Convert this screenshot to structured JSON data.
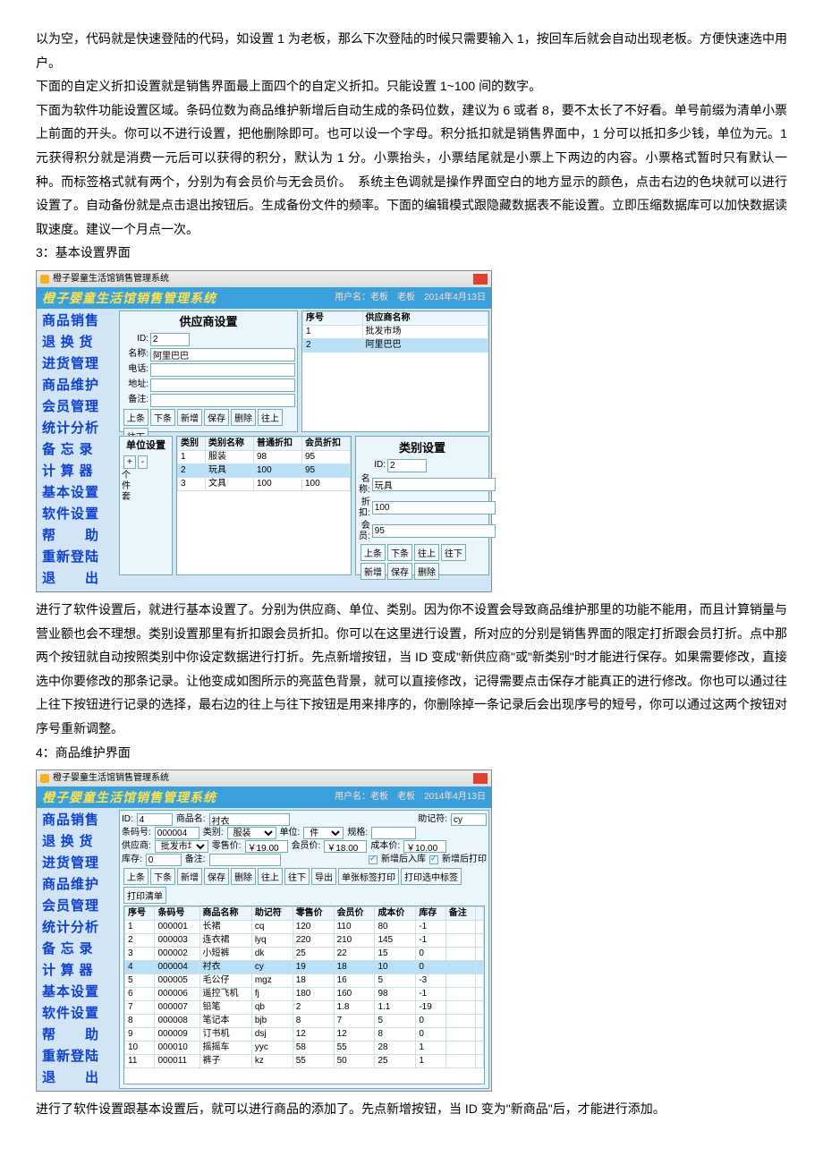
{
  "paragraphs": {
    "p1": "以为空，代码就是快速登陆的代码，如设置 1 为老板，那么下次登陆的时候只需要输入 1，按回车后就会自动出现老板。方便快速选中用户。",
    "p2": "下面的自定义折扣设置就是销售界面最上面四个的自定义折扣。只能设置 1~100 间的数字。",
    "p3": "下面为软件功能设置区域。条码位数为商品维护新增后自动生成的条码位数，建议为 6 或者 8，要不太长了不好看。单号前缀为清单小票上前面的开头。你可以不进行设置，把他删除即可。也可以设一个字母。积分抵扣就是销售界面中，1 分可以抵扣多少钱，单位为元。1 元获得积分就是消费一元后可以获得的积分，默认为 1 分。小票抬头，小票结尾就是小票上下两边的内容。小票格式暂时只有默认一种。而标签格式就有两个，分别为有会员价与无会员价。　系统主色调就是操作界面空白的地方显示的颜色，点击右边的色块就可以进行设置了。自动备份就是点击退出按钮后。生成备份文件的频率。下面的编辑模式跟隐藏数据表不能设置。立即压缩数据库可以加快数据读取速度。建议一个月点一次。",
    "h3": "3：基本设置界面",
    "p4": "进行了软件设置后，就进行基本设置了。分别为供应商、单位、类别。因为你不设置会导致商品维护那里的功能不能用，而且计算销量与营业额也会不理想。类别设置那里有折扣跟会员折扣。你可以在这里进行设置，所对应的分别是销售界面的限定打折跟会员打折。点中那两个按钮就自动按照类别中你设定数据进行打折。先点新增按钮，当 ID 变成\"新供应商\"或\"新类别\"时才能进行保存。如果需要修改，直接选中你要修改的那条记录。让他变成如图所示的亮蓝色背景，就可以直接修改，记得需要点击保存才能真正的进行修改。你也可以通过往上往下按钮进行记录的选择，最右边的往上与往下按钮是用来排序的，你删除掉一条记录后会出现序号的短号，你可以通过这两个按钮对序号重新调整。",
    "h4": "4：商品维护界面",
    "p5": "进行了软件设置跟基本设置后，就可以进行商品的添加了。先点新增按钮，当 ID 变为\"新商品\"后，才能进行添加。"
  },
  "app": {
    "title_prefix": "橙子婴童生活馆销售管理系统",
    "banner": "橙子婴童生活馆销售管理系统",
    "user_label": "用户名：老板　老板",
    "date_label": "2014年4月13日",
    "nav": [
      "商品销售",
      "退 换 货",
      "进货管理",
      "商品维护",
      "会员管理",
      "统计分析",
      "备 忘 录",
      "计 算 器",
      "基本设置",
      "软件设置",
      "帮　　助",
      "重新登陆",
      "退　　出"
    ]
  },
  "supplier": {
    "title": "供应商设置",
    "labels": {
      "id": "ID:",
      "name": "名称:",
      "phone": "电话:",
      "addr": "地址:",
      "memo": "备注:"
    },
    "values": {
      "id": "2",
      "name": "阿里巴巴"
    },
    "btns": [
      "上条",
      "下条",
      "新增",
      "保存",
      "删除",
      "往上",
      "往下"
    ],
    "grid_head": [
      "序号",
      "供应商名称"
    ],
    "grid": [
      {
        "no": "1",
        "name": "批发市场",
        "sel": false
      },
      {
        "no": "2",
        "name": "阿里巴巴",
        "sel": true
      }
    ]
  },
  "unit": {
    "title": "单位设置",
    "btns": [
      "+",
      "-"
    ],
    "items": [
      "个",
      "件",
      "套"
    ]
  },
  "catgrid": {
    "head": [
      "类别",
      "类别名称",
      "普通折扣",
      "会员折扣"
    ],
    "rows": [
      {
        "c1": "1",
        "c2": "服装",
        "c3": "98",
        "c4": "95",
        "sel": false
      },
      {
        "c1": "2",
        "c2": "玩具",
        "c3": "100",
        "c4": "95",
        "sel": true
      },
      {
        "c1": "3",
        "c2": "文具",
        "c3": "100",
        "c4": "100",
        "sel": false
      }
    ]
  },
  "cat": {
    "title": "类别设置",
    "labels": {
      "id": "ID:",
      "name": "名称:",
      "disc": "折扣:",
      "member": "会员:"
    },
    "values": {
      "id": "2",
      "name": "玩具",
      "disc": "100",
      "member": "95"
    },
    "btns1": [
      "上条",
      "下条",
      "往上",
      "往下"
    ],
    "btns2": [
      "新增",
      "保存",
      "删除"
    ]
  },
  "prod": {
    "labels": {
      "id": "ID:",
      "name": "商品名:",
      "mne": "助记符:",
      "barcode": "条码号:",
      "cat": "类别:",
      "unit": "单位:",
      "spec": "规格:",
      "supplier": "供应商:",
      "retail": "零售价:",
      "member": "会员价:",
      "cost": "成本价:",
      "stock": "库存:",
      "memo": "备注:"
    },
    "values": {
      "id": "4",
      "name": "衬衣",
      "mne": "cy",
      "barcode": "000004",
      "cat": "服装",
      "unit": "件",
      "supplier": "批发市场",
      "retail": "￥19.00",
      "member": "￥18.00",
      "cost": "￥10.00",
      "stock": "0"
    },
    "chk1": "新增后入库",
    "chk2": "新增后打印",
    "btns": [
      "上条",
      "下条",
      "新增",
      "保存",
      "删除",
      "往上",
      "往下",
      "导出",
      "单张标签打印",
      "打印选中标签",
      "打印清单"
    ],
    "grid_head": [
      "序号",
      "条码号",
      "商品名称",
      "助记符",
      "零售价",
      "会员价",
      "成本价",
      "库存",
      "备注",
      ""
    ],
    "grid": [
      {
        "c": [
          "1",
          "000001",
          "长裙",
          "cq",
          "120",
          "110",
          "80",
          "-1",
          "",
          ""
        ],
        "sel": false
      },
      {
        "c": [
          "2",
          "000003",
          "连衣裙",
          "lyq",
          "220",
          "210",
          "145",
          "-1",
          "",
          ""
        ],
        "sel": false
      },
      {
        "c": [
          "3",
          "000002",
          "小短裤",
          "dk",
          "25",
          "22",
          "15",
          "0",
          "",
          ""
        ],
        "sel": false
      },
      {
        "c": [
          "4",
          "000004",
          "衬衣",
          "cy",
          "19",
          "18",
          "10",
          "0",
          "",
          ""
        ],
        "sel": true
      },
      {
        "c": [
          "5",
          "000005",
          "毛公仔",
          "mgz",
          "18",
          "16",
          "5",
          "-3",
          "",
          ""
        ],
        "sel": false
      },
      {
        "c": [
          "6",
          "000006",
          "遥控飞机",
          "fj",
          "180",
          "160",
          "98",
          "-1",
          "",
          ""
        ],
        "sel": false
      },
      {
        "c": [
          "7",
          "000007",
          "铅笔",
          "qb",
          "2",
          "1.8",
          "1.1",
          "-19",
          "",
          ""
        ],
        "sel": false
      },
      {
        "c": [
          "8",
          "000008",
          "笔记本",
          "bjb",
          "8",
          "7",
          "5",
          "0",
          "",
          ""
        ],
        "sel": false
      },
      {
        "c": [
          "9",
          "000009",
          "订书机",
          "dsj",
          "12",
          "12",
          "8",
          "0",
          "",
          ""
        ],
        "sel": false
      },
      {
        "c": [
          "10",
          "000010",
          "摇摇车",
          "yyc",
          "58",
          "55",
          "28",
          "1",
          "",
          ""
        ],
        "sel": false
      },
      {
        "c": [
          "11",
          "000011",
          "裤子",
          "kz",
          "55",
          "50",
          "25",
          "1",
          "",
          ""
        ],
        "sel": false
      }
    ]
  }
}
